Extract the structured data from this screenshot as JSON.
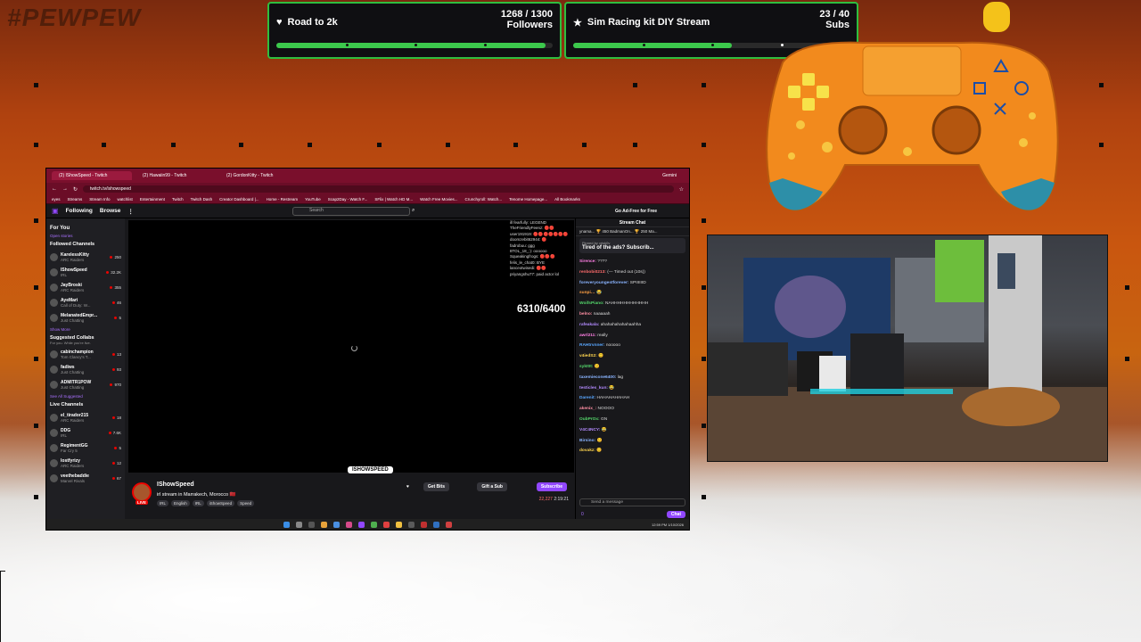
{
  "brand": "#PEWPEW",
  "goals": [
    {
      "name": "Road to 2k",
      "current": "1268 / 1300",
      "unit": "Followers",
      "progress": 0.975,
      "icon": "heart-icon"
    },
    {
      "name": "Sim Racing kit DIY Stream",
      "current": "23 / 40",
      "unit": "Subs",
      "progress": 0.575,
      "icon": "star-icon"
    }
  ],
  "colors": {
    "goal_border": "#2fbe3f",
    "twitch_purple": "#9147ff",
    "live_red": "#eb0400",
    "browser_frame": "#7a0f2c"
  },
  "browser": {
    "tabs": [
      "(2) IShowSpeed - Twitch",
      "(2) Hawaiin99 - Twitch",
      "(2) GordonKitty - Twitch"
    ],
    "profile": "Gemini",
    "url": "twitch.tv/ishowspeed",
    "bookmarks": [
      "eyes",
      "Streams",
      "Stream Info",
      "watchlist",
      "Entertainment",
      "Twitch",
      "Twitch Dash",
      "Creator Dashboard |...",
      "Home - Restream",
      "YouTube",
      "Scap2Day - Watch F...",
      "SFlix | Watch HD M...",
      "Watch Free Movies...",
      "Crunchyroll: Watch...",
      "Tenome Homepage...",
      "All Bookmarks"
    ]
  },
  "twitch": {
    "nav": {
      "following": "Following",
      "browse": "Browse",
      "search_placeholder": "Search",
      "ad_free": "Go Ad-Free for Free"
    },
    "sidebar": {
      "for_you": "For You",
      "open_stories": "Open stories",
      "followed_header": "Followed Channels",
      "followed": [
        {
          "name": "KarelessKitty",
          "game": "ARC Raiders",
          "viewers": "250"
        },
        {
          "name": "IShowSpeed",
          "game": "IRL",
          "viewers": "32.2K"
        },
        {
          "name": "JayBroski",
          "game": "ARC Raiders",
          "viewers": "355"
        },
        {
          "name": "AyeMari",
          "game": "Call of Duty: W...",
          "viewers": "46"
        },
        {
          "name": "MelanatedEmpr...",
          "game": "Just Chatting",
          "viewers": "5"
        }
      ],
      "show_more": "Show More",
      "suggested_header": "Suggested Collabs",
      "suggested_sub": "For you. While you're live.",
      "suggested": [
        {
          "name": "cabinchampion",
          "game": "Tom Clancy's T...",
          "viewers": "13"
        },
        {
          "name": "fadiws",
          "game": "Just Chatting",
          "viewers": "93"
        },
        {
          "name": "ADMITR1POW",
          "game": "Just Chatting",
          "viewers": "970"
        }
      ],
      "see_all": "See All Suggested",
      "live_header": "Live Channels",
      "live": [
        {
          "name": "el_tirador215",
          "game": "ARC Raiders",
          "viewers": "18"
        },
        {
          "name": "DDG",
          "game": "IRL",
          "viewers": "7.6K"
        },
        {
          "name": "RegimentGG",
          "game": "Far Cry 5",
          "viewers": "5"
        },
        {
          "name": "lostfyrizy",
          "game": "ARC Raiders",
          "viewers": "12"
        },
        {
          "name": "veethebaddie",
          "game": "Marvel Rivals",
          "viewers": "67"
        }
      ]
    },
    "overlay_count": "6310/6400",
    "watermark": "ISHOWSPEED",
    "mini_chat": [
      "ill fearfully: LEGEND",
      "TheFriendlyFeenz: 🔴🔴",
      "user191919: 🔴🔴🔴🔴🔴🔴🔴",
      "doomzebit62944: 🔴",
      "fadrobuu: ggg",
      "8TOL_18_:): oooooo",
      "Squeakingfrogs: 🔴🔴🔴",
      "felis_le_chat0: BYE",
      "lanceotwisedi: 🔴🔴",
      "priyangshu77: paid actor lol"
    ],
    "stream": {
      "name": "IShowSpeed",
      "title": "irl stream in Marrakech, Morocco 🇲🇦",
      "tags": [
        "IRL",
        "English",
        "IRL",
        "iShowSpeed",
        "Speed"
      ],
      "live": "LIVE",
      "viewers": "22,227",
      "uptime": "2:19:21",
      "get_bits": "Get Bits",
      "gift_sub": "Gift a Sub",
      "subscribe": "Subscribe"
    },
    "chat": {
      "header": "Stream Chat",
      "leaderboard": "ynama... 🏆 450   BadmanOn... 🏆 250   Ma...",
      "pinned_by": "Pinned by vrisk0v",
      "pinned": "Tired of the ads? Subscrib...",
      "messages": [
        {
          "user": "Sirence:",
          "text": "????",
          "color": "#ff7fe4"
        },
        {
          "user": "renbobi0213:",
          "text": "(— Timed out (10s))",
          "color": "#ff6b6b"
        },
        {
          "user": "foreveryoungestforever:",
          "text": "SPIIIIIID",
          "color": "#8ab4ff"
        },
        {
          "user": "sunpi…",
          "text": "😂",
          "color": "#ff9f43"
        },
        {
          "user": "WoifsPiano:",
          "text": "NAHHHHHHHHHHHH",
          "color": "#54d86b"
        },
        {
          "user": "belno:",
          "text": "naaaaah",
          "color": "#ff8fa3"
        },
        {
          "user": "rafeakala:",
          "text": "ahahahahahahaahha",
          "color": "#b38bff"
        },
        {
          "user": "awrl211:",
          "text": "really",
          "color": "#ff7fe4"
        },
        {
          "user": "RAHtrvnner:",
          "text": "nooooo",
          "color": "#59a7ff"
        },
        {
          "user": "v4iedS2:",
          "text": "😊",
          "color": "#ffd54f"
        },
        {
          "user": "sykt0t:",
          "text": "😊",
          "color": "#54d86b"
        },
        {
          "user": "taxemiecone6400:",
          "text": "lag",
          "color": "#8ab4ff"
        },
        {
          "user": "testicles_kun:",
          "text": "😂",
          "color": "#b38bff"
        },
        {
          "user": "Darenit:",
          "text": "HAHAHAHAHAH",
          "color": "#59a7ff"
        },
        {
          "user": "akenix_:",
          "text": "NOOOO",
          "color": "#ff8fa3"
        },
        {
          "user": "OubPrOx:",
          "text": "GN",
          "color": "#54d86b"
        },
        {
          "user": "V4C4NCY:",
          "text": "😂",
          "color": "#b38bff"
        },
        {
          "user": "Birsino:",
          "text": "😊",
          "color": "#8ab4ff"
        },
        {
          "user": "dovakz:",
          "text": "😊",
          "color": "#ffd54f"
        }
      ],
      "input_placeholder": "Send a message",
      "points": "0",
      "chat_button": "Chat"
    },
    "taskbar_clock": "12:59 PM 1/10/2026"
  }
}
